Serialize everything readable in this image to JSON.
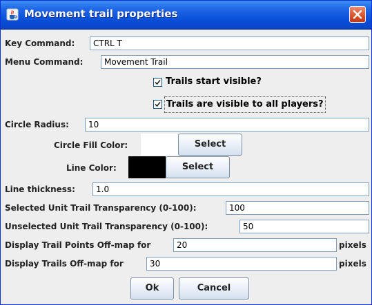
{
  "window": {
    "title": "Movement trail properties"
  },
  "fields": {
    "key_command": {
      "label": "Key Command:",
      "value": "CTRL T"
    },
    "menu_command": {
      "label": "Menu Command:",
      "value": "Movement Trail"
    },
    "trails_start_visible": {
      "label": "Trails start visible?",
      "checked": true
    },
    "trails_visible_all": {
      "label": "Trails are visible to all players?",
      "checked": true
    },
    "circle_radius": {
      "label": "Circle Radius:",
      "value": "10"
    },
    "circle_fill_color": {
      "label": "Circle Fill Color:",
      "color": "#ffffff",
      "button": "Select"
    },
    "line_color": {
      "label": "Line Color:",
      "color": "#000000",
      "button": "Select"
    },
    "line_thickness": {
      "label": "Line thickness:",
      "value": "1.0"
    },
    "selected_transparency": {
      "label": "Selected Unit Trail Transparency (0-100):",
      "value": "100"
    },
    "unselected_transparency": {
      "label": "Unselected Unit Trail Transparency (0-100):",
      "value": "50"
    },
    "trail_points_offmap": {
      "label": "Display Trail Points Off-map for",
      "value": "20",
      "unit": "pixels"
    },
    "trails_offmap": {
      "label": "Display Trails Off-map for",
      "value": "30",
      "unit": "pixels"
    }
  },
  "buttons": {
    "ok": "Ok",
    "cancel": "Cancel"
  },
  "colors": {
    "title_bar": "#0a4fd8",
    "close_button": "#d9522a",
    "panel": "#eeeeee",
    "field_border": "#7f9db9"
  }
}
